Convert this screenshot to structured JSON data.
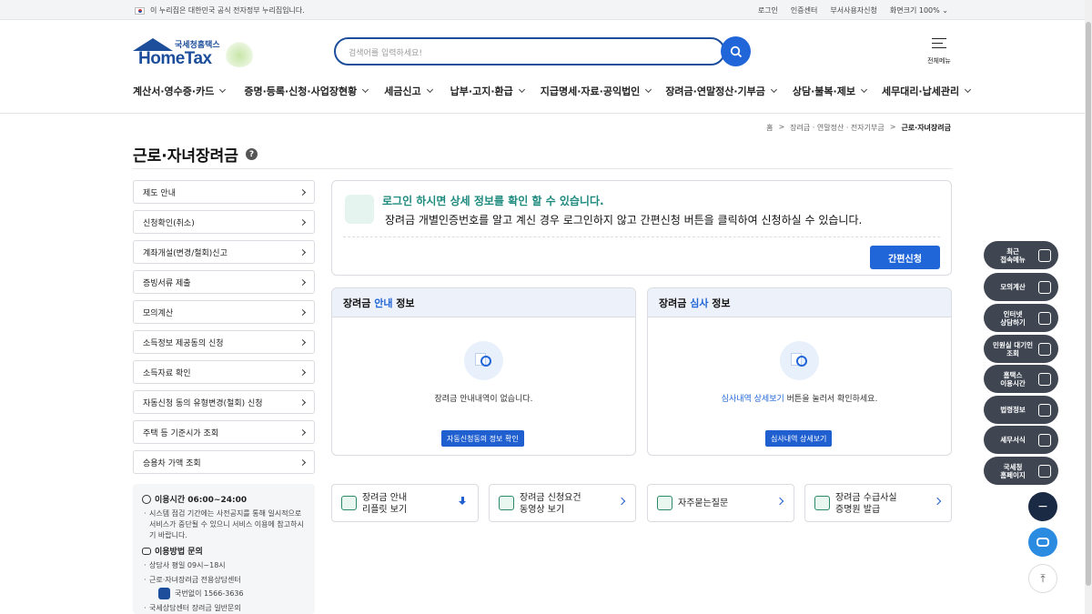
{
  "topbar": {
    "notice": "이 누리집은 대한민국 공식 전자정부 누리집입니다.",
    "links": [
      "로그인",
      "인증센터",
      "부서사용자신청",
      "화면크기 100% ⌄"
    ]
  },
  "header": {
    "logo_kr": "국세청홈택스",
    "logo_en": "HomeTax",
    "search_placeholder": "검색어를 입력하세요!",
    "menu_label": "전체메뉴",
    "gnb": [
      "계산서·영수증·카드",
      "증명·등록·신청·사업장현황",
      "세금신고",
      "납부·고지·환급",
      "지급명세·자료·공익법인",
      "장려금·연말정산·기부금",
      "상담·불복·제보",
      "세무대리·납세관리"
    ]
  },
  "breadcrumb": [
    "홈",
    ">",
    "장려금 · 연말정산 · 전자기부금",
    ">",
    "근로·자녀장려금"
  ],
  "page_title": "근로·자녀장려금",
  "sidebar": {
    "items": [
      "제도 안내",
      "신청확인(취소)",
      "계좌개설(변경/철회)신고",
      "증빙서류 제출",
      "모의계산",
      "소득정보 제공동의 신청",
      "소득자료 확인",
      "자동신청 동의 유형변경(철회) 신청",
      "주택 등 기준시가 조회",
      "승용차 가액 조회"
    ],
    "hours_title": "이용시간 06:00~24:00",
    "hours_note": "시스템 점검 기간에는 사전공지를 통해 일시적으로 서비스가 중단될 수 있으니 서비스 이용에 참고하시기 바랍니다.",
    "inquiry_title": "이용방법 문의",
    "inquiry_hours": "상담사 평일 09시~18시",
    "center": "근로·자녀장려금 전용상담센터",
    "phone": "국번없이 1566-3636",
    "homepage": "국세상담센터 장려금 일반문의"
  },
  "notice": {
    "line1": "로그인 하시면 상세 정보를 확인 할 수 있습니다.",
    "line2": "장려금 개별인증번호를 알고 계신 경우 로그인하지 않고 간편신청 버튼을 클릭하여 신청하실 수 있습니다.",
    "button": "간편신청"
  },
  "panel_guide": {
    "title_a": "장려금 ",
    "title_em": "안내",
    "title_b": " 정보",
    "message": "장려금 안내내역이 없습니다.",
    "button": "자동신청동의 정보 확인"
  },
  "panel_review": {
    "title_a": "장려금 ",
    "title_em": "심사",
    "title_b": " 정보",
    "message_link": "심사내역 상세보기",
    "message_rest": " 버튼을 눌러서 확인하세요.",
    "button": "심사내역 상세보기"
  },
  "tiles": [
    {
      "label": "장려금 안내\n리플릿 보기"
    },
    {
      "label": "장려금 신청요건\n동영상 보기"
    },
    {
      "label": "자주묻는질문"
    },
    {
      "label": "장려금 수급사실\n증명원 발급"
    }
  ],
  "quick_menu": [
    "최근\n접속메뉴",
    "모의계산",
    "인터넷\n상담하기",
    "민원실 대기인\n조회",
    "홈택스\n이용시간",
    "법령정보",
    "세무서식",
    "국세청\n홈페이지"
  ],
  "fabs": {
    "minus": "−",
    "top": "⤒"
  }
}
